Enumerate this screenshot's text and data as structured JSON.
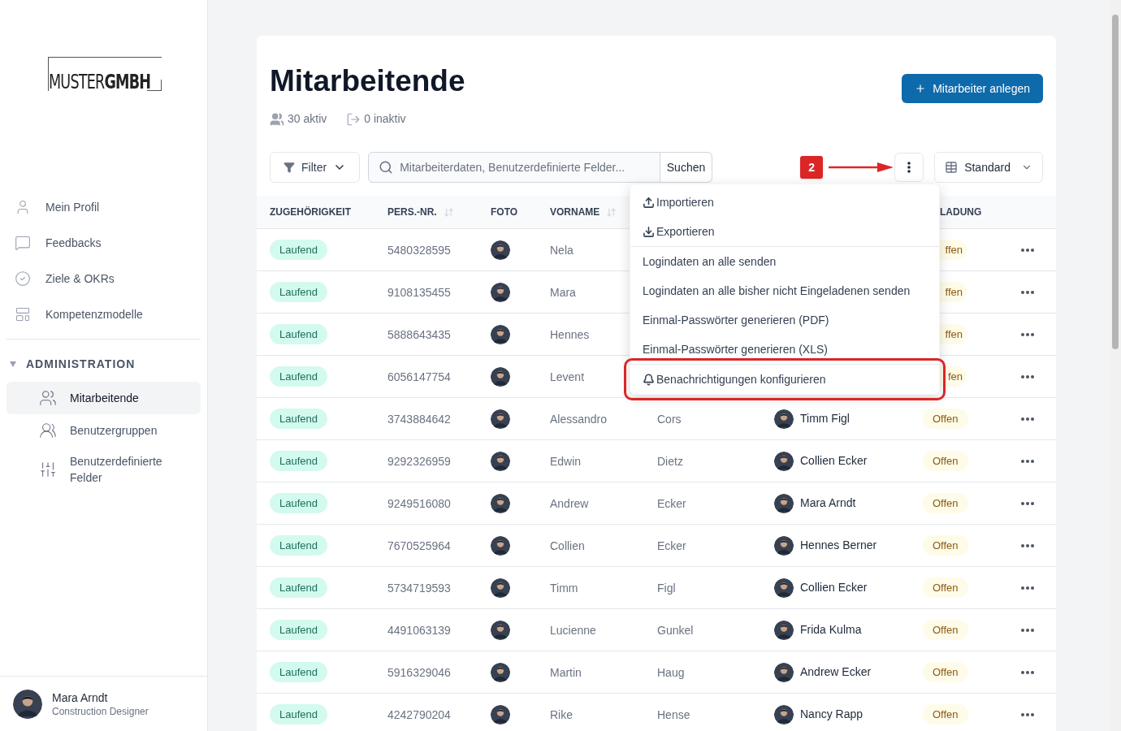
{
  "logo": {
    "light": "MUSTER",
    "bold": "GMBH"
  },
  "sidebar": {
    "items": [
      {
        "label": "Mein Profil"
      },
      {
        "label": "Feedbacks"
      },
      {
        "label": "Ziele & OKRs"
      },
      {
        "label": "Kompetenzmodelle"
      }
    ],
    "section": {
      "title": "ADMINISTRATION",
      "expanded": true,
      "items": [
        {
          "label": "Mitarbeitende",
          "selected": true
        },
        {
          "label": "Benutzergruppen",
          "selected": false
        },
        {
          "label": "Benutzerdefinierte Felder",
          "selected": false
        }
      ]
    },
    "user": {
      "name": "Mara Arndt",
      "role": "Construction Designer"
    }
  },
  "page": {
    "title": "Mitarbeitende",
    "active": "30 aktiv",
    "inactive": "0 inaktiv",
    "create_button": "Mitarbeiter anlegen"
  },
  "toolbar": {
    "filter": "Filter",
    "search_placeholder": "Mitarbeiterdaten, Benutzerdefinierte Felder...",
    "search_button": "Suchen",
    "view": "Standard"
  },
  "annotation": {
    "badge": "2"
  },
  "menu": {
    "sections": [
      [
        {
          "label": "Importieren",
          "highlighted": false
        },
        {
          "label": "Exportieren",
          "highlighted": false
        }
      ],
      [
        {
          "label": "Logindaten an alle senden",
          "highlighted": false
        },
        {
          "label": "Logindaten an alle bisher nicht Eingeladenen senden",
          "highlighted": false
        },
        {
          "label": "Einmal-Passwörter generieren (PDF)",
          "highlighted": false
        },
        {
          "label": "Einmal-Passwörter generieren (XLS)",
          "highlighted": false
        }
      ],
      [
        {
          "label": "Benachrichtigungen konfigurieren",
          "highlighted": true
        }
      ]
    ]
  },
  "table": {
    "columns": [
      {
        "label": "ZUGEHÖRIGKEIT",
        "sortable": false
      },
      {
        "label": "PERS.-NR.",
        "sortable": true
      },
      {
        "label": "FOTO",
        "sortable": false
      },
      {
        "label": "VORNAME",
        "sortable": true
      },
      {
        "label": "LADUNG",
        "sortable": false
      }
    ],
    "rows": [
      {
        "membership": "Laufend",
        "number": "5480328595",
        "first_name": "Nela",
        "invitation": "ffen"
      },
      {
        "membership": "Laufend",
        "number": "9108135455",
        "first_name": "Mara",
        "invitation": "ffen"
      },
      {
        "membership": "Laufend",
        "number": "5888643435",
        "first_name": "Hennes",
        "invitation": "ffen"
      },
      {
        "membership": "Laufend",
        "number": "6056147754",
        "first_name": "Levent",
        "invitation": "fen"
      },
      {
        "membership": "Laufend",
        "number": "3743884642",
        "first_name": "Alessandro",
        "last_name": "Cors",
        "manager": "Timm Figl",
        "invitation": "Offen"
      },
      {
        "membership": "Laufend",
        "number": "9292326959",
        "first_name": "Edwin",
        "last_name": "Dietz",
        "manager": "Collien Ecker",
        "invitation": "Offen"
      },
      {
        "membership": "Laufend",
        "number": "9249516080",
        "first_name": "Andrew",
        "last_name": "Ecker",
        "manager": "Mara Arndt",
        "invitation": "Offen"
      },
      {
        "membership": "Laufend",
        "number": "7670525964",
        "first_name": "Collien",
        "last_name": "Ecker",
        "manager": "Hennes Berner",
        "invitation": "Offen"
      },
      {
        "membership": "Laufend",
        "number": "5734719593",
        "first_name": "Timm",
        "last_name": "Figl",
        "manager": "Collien Ecker",
        "invitation": "Offen"
      },
      {
        "membership": "Laufend",
        "number": "4491063139",
        "first_name": "Lucienne",
        "last_name": "Gunkel",
        "manager": "Frida Kulma",
        "invitation": "Offen"
      },
      {
        "membership": "Laufend",
        "number": "5916329046",
        "first_name": "Martin",
        "last_name": "Haug",
        "manager": "Andrew Ecker",
        "invitation": "Offen"
      },
      {
        "membership": "Laufend",
        "number": "4242790204",
        "first_name": "Rike",
        "last_name": "Hense",
        "manager": "Nancy Rapp",
        "invitation": "Offen"
      }
    ]
  }
}
